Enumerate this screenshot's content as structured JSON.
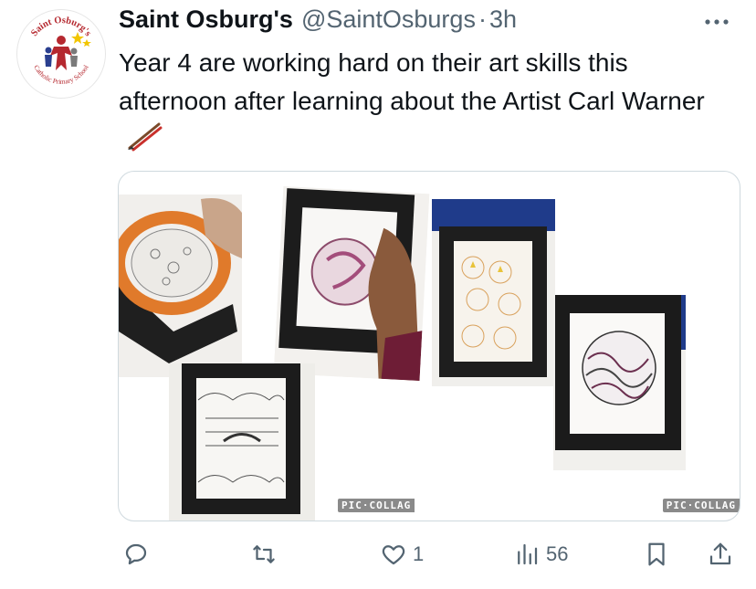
{
  "tweet": {
    "display_name": "Saint Osburg's",
    "handle": "@SaintOsburgs",
    "separator": "·",
    "time_ago": "3h",
    "text": "Year 4 are working hard on their art skills this afternoon after learning about the Artist Carl Warner",
    "emoji_icon": "paintbrush-icon"
  },
  "avatar": {
    "logo_text_top": "Saint Osburg's",
    "logo_text_bottom": "Catholic Primary School"
  },
  "media": {
    "watermark_left": "PIC·COLLAG",
    "watermark_right": "PIC·COLLAG",
    "photo_count": 6
  },
  "actions": {
    "reply_icon": "reply-icon",
    "retweet_icon": "retweet-icon",
    "like_icon": "heart-icon",
    "like_count": "1",
    "views_icon": "views-icon",
    "views_count": "56",
    "bookmark_icon": "bookmark-icon",
    "share_icon": "share-icon"
  },
  "colors": {
    "text_primary": "#0f1419",
    "text_secondary": "#536471",
    "border": "#cfd9de",
    "logo_red": "#b5282f",
    "logo_star": "#f2c500"
  }
}
